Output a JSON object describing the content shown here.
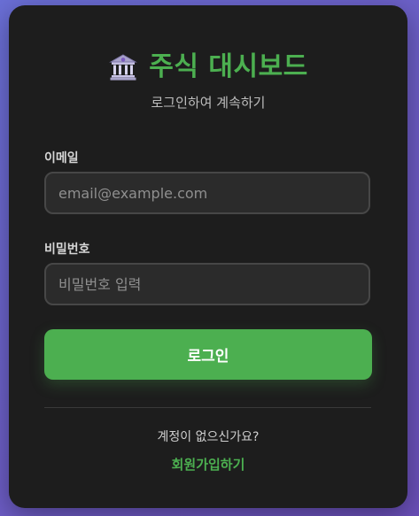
{
  "header": {
    "icon": "bank-building-icon",
    "title": "주식 대시보드",
    "subtitle": "로그인하여 계속하기"
  },
  "form": {
    "email": {
      "label": "이메일",
      "placeholder": "email@example.com",
      "value": ""
    },
    "password": {
      "label": "비밀번호",
      "placeholder": "비밀번호 입력",
      "value": ""
    },
    "login_label": "로그인"
  },
  "footer": {
    "no_account_text": "계정이 없으신가요?",
    "signup_label": "회원가입하기"
  },
  "colors": {
    "accent": "#4caf50",
    "card_background": "#1d1d1d",
    "input_background": "#2b2b2b",
    "page_gradient_start": "#6a6fd6",
    "page_gradient_end": "#6a4fb8"
  }
}
